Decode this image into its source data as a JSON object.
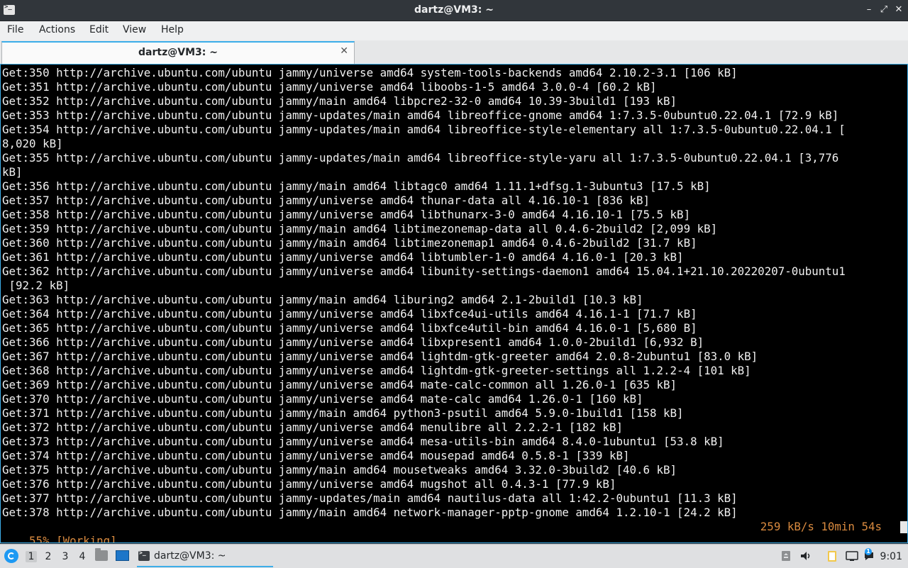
{
  "window": {
    "title": "dartz@VM3: ~",
    "minimize_glyph": "–",
    "maximize_glyph": "⤢",
    "close_glyph": "✕"
  },
  "menubar": {
    "items": [
      "File",
      "Actions",
      "Edit",
      "View",
      "Help"
    ]
  },
  "tabs": [
    {
      "label": "dartz@VM3: ~",
      "close_glyph": "✕"
    }
  ],
  "terminal": {
    "lines": [
      "Get:350 http://archive.ubuntu.com/ubuntu jammy/universe amd64 system-tools-backends amd64 2.10.2-3.1 [106 kB]",
      "Get:351 http://archive.ubuntu.com/ubuntu jammy/universe amd64 liboobs-1-5 amd64 3.0.0-4 [60.2 kB]",
      "Get:352 http://archive.ubuntu.com/ubuntu jammy/main amd64 libpcre2-32-0 amd64 10.39-3build1 [193 kB]",
      "Get:353 http://archive.ubuntu.com/ubuntu jammy-updates/main amd64 libreoffice-gnome amd64 1:7.3.5-0ubuntu0.22.04.1 [72.9 kB]",
      "Get:354 http://archive.ubuntu.com/ubuntu jammy-updates/main amd64 libreoffice-style-elementary all 1:7.3.5-0ubuntu0.22.04.1 [",
      "8,020 kB]",
      "Get:355 http://archive.ubuntu.com/ubuntu jammy-updates/main amd64 libreoffice-style-yaru all 1:7.3.5-0ubuntu0.22.04.1 [3,776",
      "kB]",
      "Get:356 http://archive.ubuntu.com/ubuntu jammy/main amd64 libtagc0 amd64 1.11.1+dfsg.1-3ubuntu3 [17.5 kB]",
      "Get:357 http://archive.ubuntu.com/ubuntu jammy/universe amd64 thunar-data all 4.16.10-1 [836 kB]",
      "Get:358 http://archive.ubuntu.com/ubuntu jammy/universe amd64 libthunarx-3-0 amd64 4.16.10-1 [75.5 kB]",
      "Get:359 http://archive.ubuntu.com/ubuntu jammy/main amd64 libtimezonemap-data all 0.4.6-2build2 [2,099 kB]",
      "Get:360 http://archive.ubuntu.com/ubuntu jammy/main amd64 libtimezonemap1 amd64 0.4.6-2build2 [31.7 kB]",
      "Get:361 http://archive.ubuntu.com/ubuntu jammy/universe amd64 libtumbler-1-0 amd64 4.16.0-1 [20.3 kB]",
      "Get:362 http://archive.ubuntu.com/ubuntu jammy/universe amd64 libunity-settings-daemon1 amd64 15.04.1+21.10.20220207-0ubuntu1",
      " [92.2 kB]",
      "Get:363 http://archive.ubuntu.com/ubuntu jammy/main amd64 liburing2 amd64 2.1-2build1 [10.3 kB]",
      "Get:364 http://archive.ubuntu.com/ubuntu jammy/universe amd64 libxfce4ui-utils amd64 4.16.1-1 [71.7 kB]",
      "Get:365 http://archive.ubuntu.com/ubuntu jammy/universe amd64 libxfce4util-bin amd64 4.16.0-1 [5,680 B]",
      "Get:366 http://archive.ubuntu.com/ubuntu jammy/universe amd64 libxpresent1 amd64 1.0.0-2build1 [6,932 B]",
      "Get:367 http://archive.ubuntu.com/ubuntu jammy/universe amd64 lightdm-gtk-greeter amd64 2.0.8-2ubuntu1 [83.0 kB]",
      "Get:368 http://archive.ubuntu.com/ubuntu jammy/universe amd64 lightdm-gtk-greeter-settings all 1.2.2-4 [101 kB]",
      "Get:369 http://archive.ubuntu.com/ubuntu jammy/universe amd64 mate-calc-common all 1.26.0-1 [635 kB]",
      "Get:370 http://archive.ubuntu.com/ubuntu jammy/universe amd64 mate-calc amd64 1.26.0-1 [160 kB]",
      "Get:371 http://archive.ubuntu.com/ubuntu jammy/main amd64 python3-psutil amd64 5.9.0-1build1 [158 kB]",
      "Get:372 http://archive.ubuntu.com/ubuntu jammy/universe amd64 menulibre all 2.2.2-1 [182 kB]",
      "Get:373 http://archive.ubuntu.com/ubuntu jammy/universe amd64 mesa-utils-bin amd64 8.4.0-1ubuntu1 [53.8 kB]",
      "Get:374 http://archive.ubuntu.com/ubuntu jammy/universe amd64 mousepad amd64 0.5.8-1 [339 kB]",
      "Get:375 http://archive.ubuntu.com/ubuntu jammy/main amd64 mousetweaks amd64 3.32.0-3build2 [40.6 kB]",
      "Get:376 http://archive.ubuntu.com/ubuntu jammy/universe amd64 mugshot all 0.4.3-1 [77.9 kB]",
      "Get:377 http://archive.ubuntu.com/ubuntu jammy-updates/main amd64 nautilus-data all 1:42.2-0ubuntu1 [11.3 kB]",
      "Get:378 http://archive.ubuntu.com/ubuntu jammy/main amd64 network-manager-pptp-gnome amd64 1.2.10-1 [24.2 kB]"
    ],
    "status_left": "55% [Working]",
    "status_right": "259 kB/s 10min 54s",
    "status_color": "#d98a3f"
  },
  "taskbar": {
    "workspaces": [
      "1",
      "2",
      "3",
      "4"
    ],
    "active_workspace": "1",
    "launchers": [
      "file-manager-icon",
      "show-desktop-icon"
    ],
    "task_label": "dartz@VM3: ~",
    "tray_icons": [
      "removable-drive-icon",
      "volume-icon",
      "clipboard-icon",
      "network-icon",
      "notification-icon"
    ],
    "notification_count": "1",
    "clock": "9:01",
    "accent": "#3daee9"
  }
}
